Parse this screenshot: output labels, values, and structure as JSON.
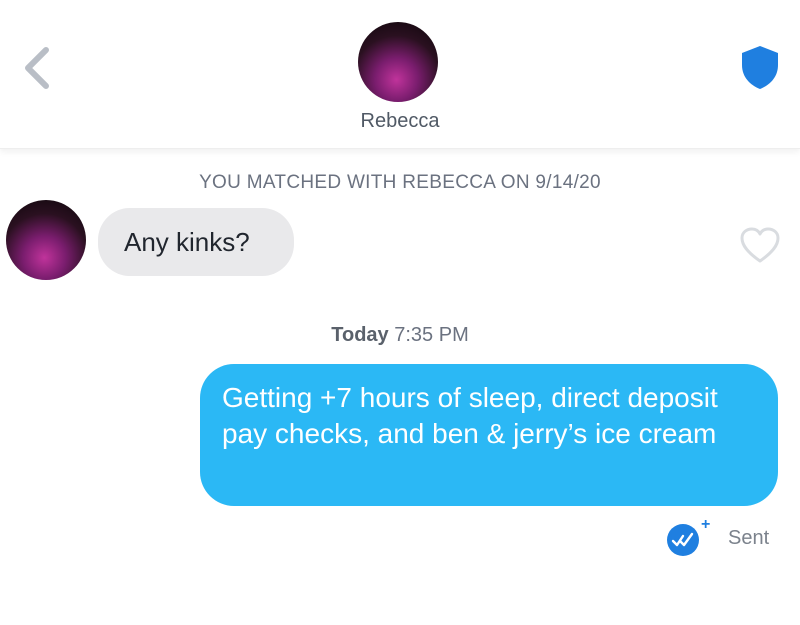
{
  "header": {
    "back_icon": "chevron-left-icon",
    "contact_name": "Rebecca",
    "safety_icon": "shield-icon",
    "safety_color": "#1f7fe0"
  },
  "conversation": {
    "match_banner": "YOU MATCHED WITH REBECCA ON 9/14/20",
    "incoming": {
      "text": "Any kinks?",
      "like_icon": "heart-outline-icon"
    },
    "timestamp": {
      "day": "Today",
      "time": "7:35 PM"
    },
    "outgoing": {
      "text": "Getting +7 hours of sleep, direct deposit pay checks, and ben & jerry’s ice cream",
      "bubble_color": "#2bb8f5"
    },
    "status": {
      "receipt_icon": "read-receipt-check-icon",
      "receipt_badge": "+",
      "label": "Sent"
    }
  }
}
